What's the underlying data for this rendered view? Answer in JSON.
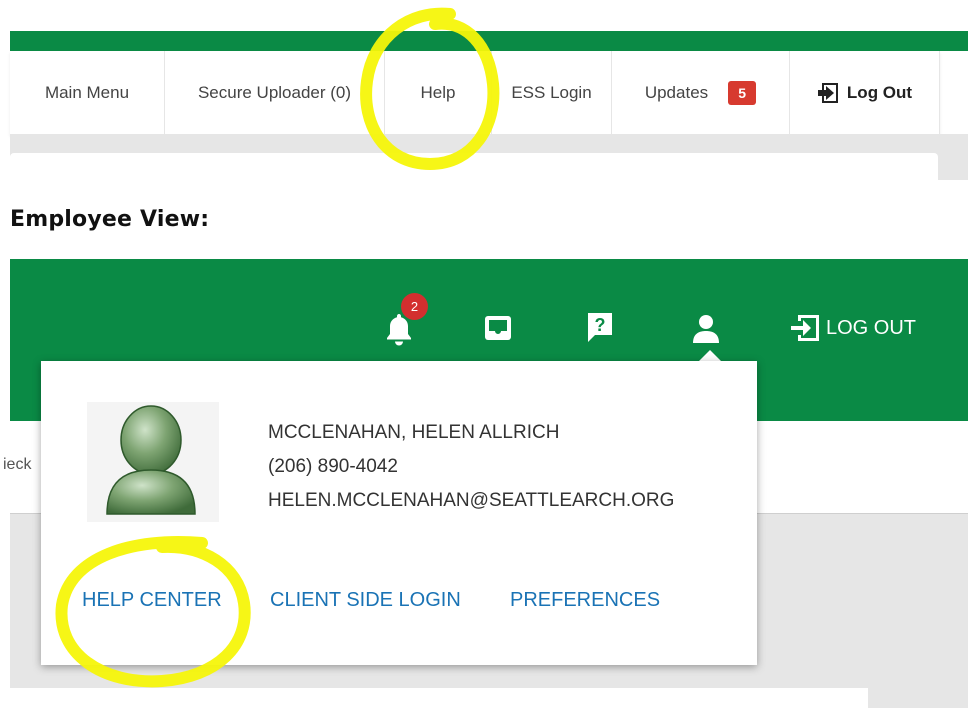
{
  "admin_nav": {
    "main_menu": "Main Menu",
    "secure_uploader": "Secure Uploader (0)",
    "help": "Help",
    "ess_login": "ESS Login",
    "updates": "Updates",
    "updates_count": "5",
    "logout": "Log Out"
  },
  "heading": "Employee View:",
  "employee_header": {
    "notifications_count": "2",
    "logout": "LOG OUT"
  },
  "background_text": "ieck",
  "user_menu": {
    "name": "MCCLENAHAN, HELEN ALLRICH",
    "phone": "(206) 890-4042",
    "email": "HELEN.MCCLENAHAN@SEATTLEARCH.ORG",
    "links": [
      "HELP CENTER",
      "CLIENT SIDE LOGIN",
      "PREFERENCES"
    ]
  },
  "colors": {
    "brand_green": "#0a8a45",
    "badge_red": "#d73a2f",
    "link_blue": "#1a73b5",
    "highlight_yellow": "#f5f50a"
  },
  "icons": [
    "logout-icon",
    "bell-icon",
    "inbox-icon",
    "help-icon",
    "user-icon",
    "avatar-silhouette"
  ]
}
